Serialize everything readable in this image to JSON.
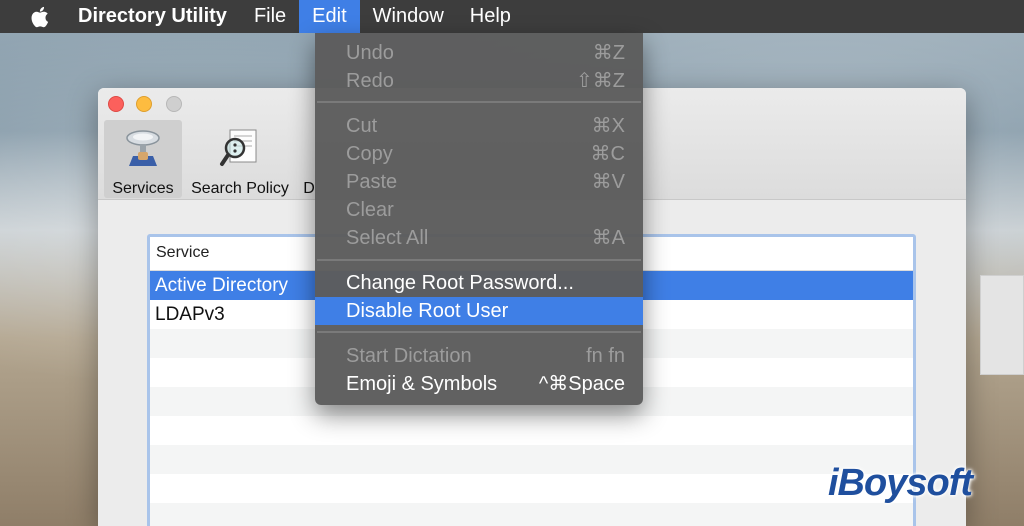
{
  "menubar": {
    "app_name": "Directory Utility",
    "menus": [
      "File",
      "Edit",
      "Window",
      "Help"
    ],
    "active_menu": "Edit"
  },
  "window": {
    "toolbar": {
      "services": "Services",
      "search_policy": "Search Policy",
      "directory_partial": "D"
    },
    "table": {
      "header": "Service",
      "rows": [
        "Active Directory",
        "LDAPv3"
      ],
      "selected_row": "Active Directory"
    }
  },
  "edit_menu": {
    "items": [
      {
        "label": "Undo",
        "shortcut": "⌘Z",
        "enabled": false
      },
      {
        "label": "Redo",
        "shortcut": "⇧⌘Z",
        "enabled": false
      },
      {
        "label": "Cut",
        "shortcut": "⌘X",
        "enabled": false
      },
      {
        "label": "Copy",
        "shortcut": "⌘C",
        "enabled": false
      },
      {
        "label": "Paste",
        "shortcut": "⌘V",
        "enabled": false
      },
      {
        "label": "Clear",
        "shortcut": "",
        "enabled": false
      },
      {
        "label": "Select All",
        "shortcut": "⌘A",
        "enabled": false
      },
      {
        "label": "Change Root Password...",
        "shortcut": "",
        "enabled": true
      },
      {
        "label": "Disable Root User",
        "shortcut": "",
        "enabled": true,
        "highlighted": true
      },
      {
        "label": "Start Dictation",
        "shortcut": "fn fn",
        "enabled": false
      },
      {
        "label": "Emoji & Symbols",
        "shortcut": "^⌘Space",
        "enabled": true
      }
    ]
  },
  "watermark": "iBoysoft",
  "colors": {
    "accent": "#3f7fe6",
    "menubar": "#3d3d3d",
    "menu_bg": "#5c5c5c",
    "watermark": "#1f4f9e"
  }
}
